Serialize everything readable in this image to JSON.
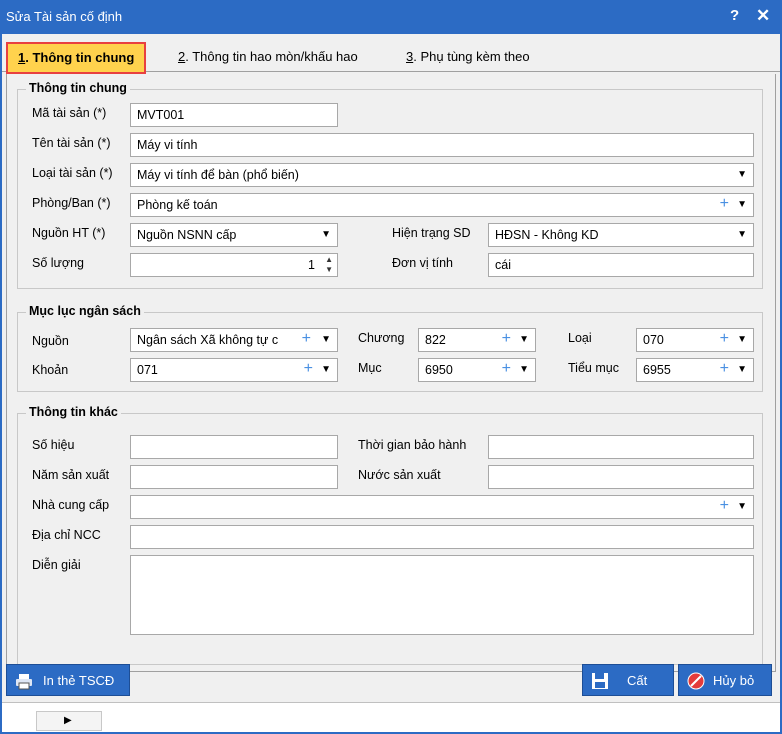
{
  "window": {
    "title": "Sửa Tài sản cố định",
    "help": "?",
    "close": "✕"
  },
  "tabs": [
    {
      "key": "1",
      "label": ". Thông tin chung"
    },
    {
      "key": "2",
      "label": ". Thông tin hao mòn/khấu hao"
    },
    {
      "key": "3",
      "label": ". Phụ tùng kèm theo"
    }
  ],
  "general": {
    "title": "Thông tin chung",
    "ma_label": "Mã tài sản (*)",
    "ma_value": "MVT001",
    "ten_label": "Tên tài sản (*)",
    "ten_value": "Máy vi tính",
    "loai_label": "Loại tài sản (*)",
    "loai_value": "Máy vi tính để bàn (phổ biến)",
    "phong_label": "Phòng/Ban (*)",
    "phong_value": "Phòng kế toán",
    "nguon_label": "Nguồn HT (*)",
    "nguon_value": "Nguồn NSNN cấp",
    "hientrang_label": "Hiện trạng SD",
    "hientrang_value": "HĐSN - Không KD",
    "soluong_label": "Số lượng",
    "soluong_value": "1",
    "donvi_label": "Đơn vị tính",
    "donvi_value": "cái"
  },
  "budget": {
    "title": "Mục lục ngân sách",
    "nguon_label": "Nguồn",
    "nguon_value": "Ngân sách Xã không tự c",
    "chuong_label": "Chương",
    "chuong_value": "822",
    "loai_label": "Loại",
    "loai_value": "070",
    "khoan_label": "Khoản",
    "khoan_value": "071",
    "muc_label": "Mục",
    "muc_value": "6950",
    "tieumuc_label": "Tiểu mục",
    "tieumuc_value": "6955"
  },
  "other": {
    "title": "Thông tin khác",
    "sohieu_label": "Số hiệu",
    "sohieu_value": "",
    "baohanh_label": "Thời gian bảo hành",
    "baohanh_value": "",
    "namsx_label": "Năm sản xuất",
    "namsx_value": "",
    "nuocsx_label": "Nước sản xuất",
    "nuocsx_value": "",
    "ncc_label": "Nhà cung cấp",
    "ncc_value": "",
    "diachi_label": "Địa chỉ NCC",
    "diachi_value": "",
    "diengiai_label": "Diễn giải",
    "diengiai_value": ""
  },
  "buttons": {
    "print": "In thẻ TSCĐ",
    "save": "Cất",
    "cancel": "Hủy bỏ"
  },
  "icons": {
    "dropdown": "chevron-down-icon",
    "add": "plus-icon",
    "spin": "spinner-icon",
    "print": "printer-icon",
    "save": "floppy-icon",
    "cancel": "cancel-icon"
  },
  "colors": {
    "titlebar": "#2c6bc4",
    "active_tab": "#ffd24d",
    "tab_highlight": "#e84040",
    "plus": "#4a90e2"
  }
}
